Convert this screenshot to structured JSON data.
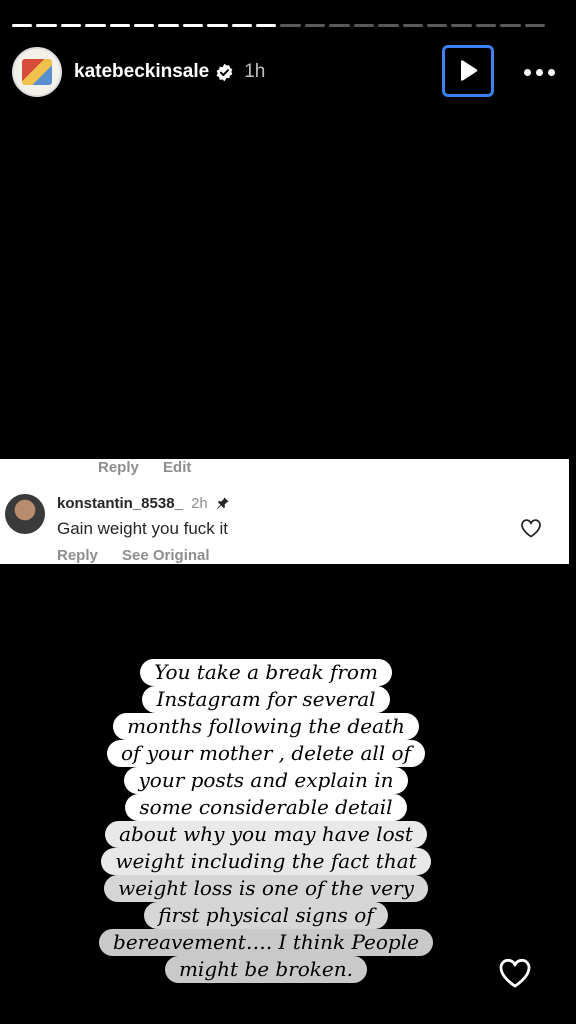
{
  "progress": {
    "total": 22,
    "completed": 11
  },
  "header": {
    "username": "katebeckinsale",
    "time": "1h",
    "verified": true,
    "avatar_icon": "profile-avatar-icon",
    "play_icon": "play-icon",
    "more_icon": "more-options-icon"
  },
  "screenshot_comment": {
    "prev_actions": {
      "reply": "Reply",
      "edit": "Edit"
    },
    "username": "konstantin_8538_",
    "time": "2h",
    "pinned_icon": "pin-icon",
    "text": "Gain weight you fuck it",
    "actions": {
      "reply": "Reply",
      "see_original": "See Original"
    },
    "like_icon": "heart-outline-icon"
  },
  "story_text": {
    "lines": [
      "You take a break from",
      "Instagram for several",
      "months following the death",
      "of your mother , delete all of",
      "your posts and explain in",
      "some considerable detail",
      "about why you may have lost",
      "weight including the fact that",
      "weight loss is one of the very",
      "first physical signs of",
      "bereavement…. I think People",
      "might be broken."
    ]
  },
  "footer": {
    "like_icon": "heart-outline-icon"
  },
  "colors": {
    "accent": "#3b82f6",
    "background": "#000000",
    "card": "#ffffff"
  }
}
